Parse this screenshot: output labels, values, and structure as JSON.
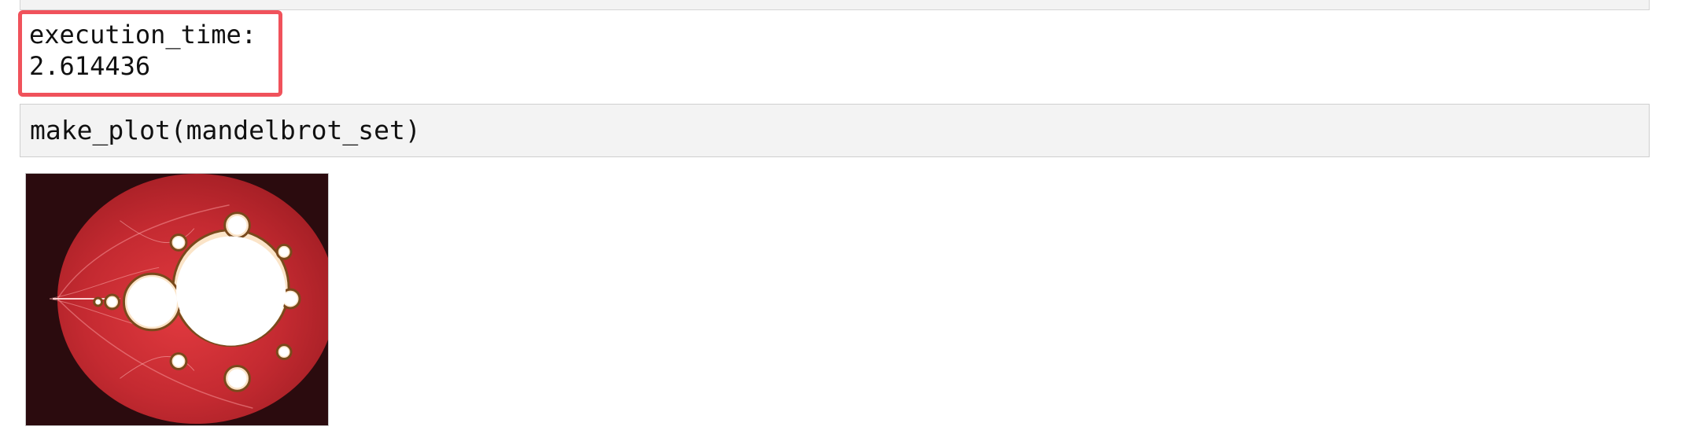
{
  "output": {
    "line1": "execution_time:",
    "line2": "2.614436"
  },
  "prompt": {
    "marker": ":"
  },
  "code_cell": {
    "code": "make_plot(mandelbrot_set)"
  },
  "plot": {
    "content": "mandelbrot-set-fractal",
    "colors": {
      "background": "#2b0b0e",
      "disc": "#b8242b",
      "set": "#ffffff",
      "accent": "#f0525b"
    }
  },
  "highlight": {
    "color": "#f0525b"
  }
}
